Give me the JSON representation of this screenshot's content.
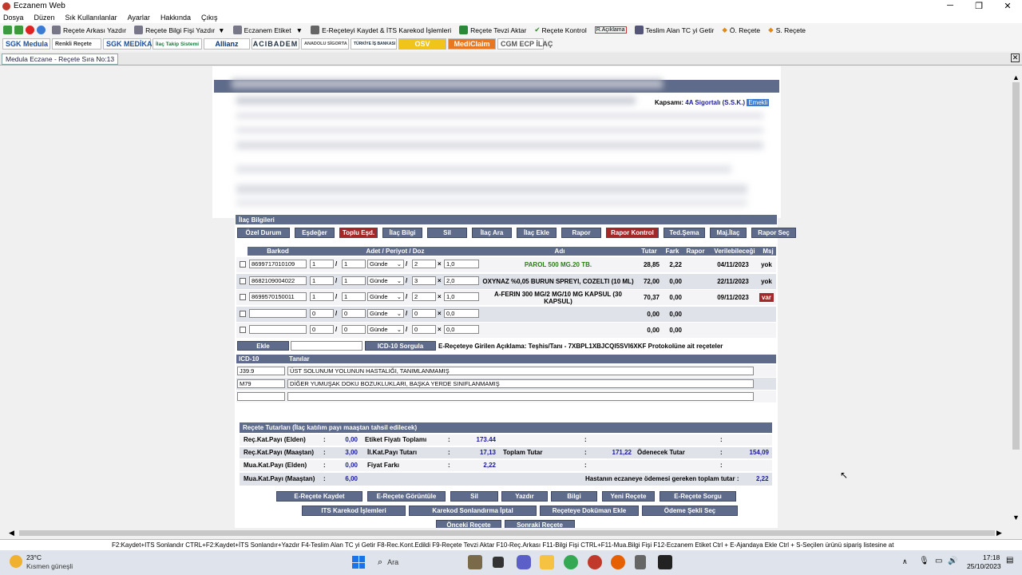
{
  "window": {
    "title": "Eczanem Web"
  },
  "menu": [
    "Dosya",
    "Düzen",
    "Sık Kullanılanlar",
    "Ayarlar",
    "Hakkında",
    "Çıkış"
  ],
  "toolbar1": [
    "Reçete Arkası Yazdır",
    "Reçete Bilgi Fişi Yazdır",
    "Eczanem Etiket",
    "E-Reçeteyi Kaydet & İTS Karekod İşlemleri",
    "Reçete Tevzi Aktar",
    "Reçete Kontrol",
    "R.Açıklama",
    "Teslim Alan TC yi Getir",
    "Ö. Reçete",
    "S. Reçete"
  ],
  "toolbar2": [
    "SGK Medula",
    "Renkli Reçete",
    "SGK MEDİKAL",
    "İlaç Takip Sistemi",
    "Allianz",
    "ACIBADEM",
    "ANADOLU SİGORTA",
    "TÜRKİYE İŞ BANKASI",
    "OSV",
    "MediClaim",
    "CGM ECP İLAÇ"
  ],
  "tab": {
    "label": "Medula Eczane - Reçete Sıra No:13"
  },
  "kapsam": {
    "label": "Kapsamı:",
    "value": "4A Sigortalı (S.S.K.)",
    "badge": "Emekli"
  },
  "ilac": {
    "section_title": "İlaç Bilgileri",
    "buttons": [
      "Özel Durum",
      "Eşdeğer",
      "Toplu Eşd.",
      "İlaç Bilgi",
      "Sil",
      "İlaç Ara",
      "İlaç Ekle",
      "Rapor",
      "Rapor Kontrol",
      "Ted.Şema",
      "Maj.İlaç",
      "Rapor Seç"
    ],
    "columns": [
      "Barkod",
      "Adet / Periyot / Doz",
      "Adı",
      "Tutar",
      "Fark",
      "Rapor",
      "Verilebileceği",
      "Msj"
    ],
    "rows": [
      {
        "barkod": "8699717010109",
        "adet": "1",
        "periyot": "1",
        "birim": "Günde",
        "doz1": "2",
        "doz2": "1,0",
        "adi": "PAROL 500 MG.20 TB.",
        "tutar": "28,85",
        "fark": "2,22",
        "rapor": "",
        "verilebilecegi": "04/11/2023",
        "msj": "yok"
      },
      {
        "barkod": "8682109004022",
        "adet": "1",
        "periyot": "1",
        "birim": "Günde",
        "doz1": "3",
        "doz2": "2,0",
        "adi": "OXYNAZ %0,05 BURUN SPREYI, COZELTI (10 ML)",
        "tutar": "72,00",
        "fark": "0,00",
        "rapor": "",
        "verilebilecegi": "22/11/2023",
        "msj": "yok"
      },
      {
        "barkod": "8699570150011",
        "adet": "1",
        "periyot": "1",
        "birim": "Günde",
        "doz1": "2",
        "doz2": "1,0",
        "adi": "A-FERIN 300 MG/2 MG/10 MG KAPSUL (30 KAPSUL)",
        "tutar": "70,37",
        "fark": "0,00",
        "rapor": "",
        "verilebilecegi": "09/11/2023",
        "msj": "var"
      },
      {
        "barkod": "",
        "adet": "0",
        "periyot": "0",
        "birim": "Günde",
        "doz1": "0",
        "doz2": "0,0",
        "adi": "",
        "tutar": "0,00",
        "fark": "0,00",
        "rapor": "",
        "verilebilecegi": "",
        "msj": ""
      },
      {
        "barkod": "",
        "adet": "0",
        "periyot": "0",
        "birim": "Günde",
        "doz1": "0",
        "doz2": "0,0",
        "adi": "",
        "tutar": "0,00",
        "fark": "0,00",
        "rapor": "",
        "verilebilecegi": "",
        "msj": ""
      }
    ],
    "ekle": "Ekle",
    "icd_sorgula": "ICD-10 Sorgula",
    "aciklama": "E-Reçeteye Girilen Açıklama: Teşhis/Tanı - 7XBPL1XBJCQI5SVI6XKF Protokolüne ait reçeteler"
  },
  "icd": {
    "columns": [
      "ICD-10",
      "Tanılar"
    ],
    "rows": [
      {
        "code": "J39.9",
        "desc": "ÜST SOLUNUM YOLUNUN HASTALIĞI, TANIMLANMAMIŞ"
      },
      {
        "code": "M79",
        "desc": "DİĞER YUMUŞAK DOKU BOZUKLUKLARI, BAŞKA YERDE SINIFLANMAMIŞ"
      },
      {
        "code": "",
        "desc": ""
      }
    ]
  },
  "tutar": {
    "title": "Reçete Tutarları (İlaç katılım payı maaştan tahsil edilecek)",
    "rec_kat_elden_label": "Reç.Kat.Payı (Elden)",
    "rec_kat_elden": "0,00",
    "etiket_label": "Etiket Fiyatı Toplamı",
    "etiket": "173.44",
    "rec_kat_maas_label": "Reç.Kat.Payı (Maaştan)",
    "rec_kat_maas": "3,00",
    "il_kat_label": "İl.Kat.Payı Tutarı",
    "il_kat": "17,13",
    "toplam_label": "Toplam Tutar",
    "toplam": "171,22",
    "odenecek_label": "Ödenecek Tutar",
    "odenecek": "154,09",
    "mua_elden_label": "Mua.Kat.Payı (Elden)",
    "mua_elden": "0,00",
    "fiyat_farki_label": "Fiyat Farkı",
    "fiyat_farki": "2,22",
    "mua_maas_label": "Mua.Kat.Payı (Maaştan)",
    "mua_maas": "6,00",
    "hasta_label": "Hastanın eczaneye ödemesi gereken toplam tutar :",
    "hasta": "2,22"
  },
  "actions": {
    "row1": [
      "E-Reçete Kaydet",
      "E-Reçete Görüntüle",
      "Sil",
      "Yazdır",
      "Bilgi",
      "Yeni Reçete",
      "E-Reçete Sorgu"
    ],
    "row2": [
      "ITS Karekod İşlemleri",
      "Karekod Sonlandırma İptal",
      "Reçeteye Doküman Ekle",
      "Ödeme Şekli Seç"
    ],
    "row3": [
      "Önceki Reçete",
      "Sonraki Reçete"
    ]
  },
  "statusbar": "F2:Kaydet+ITS Sonlandır CTRL+F2:Kaydet+İTS Sonlandır+Yazdır  F4-Teslim Alan TC yi Getir  F8-Rec.Kont.Edildi  F9-Reçete Tevzi Aktar  F10-Reç.Arkası  F11-Bilgi Fişi CTRL+F11-Mua.Bilgi Fişi  F12-Eczanem Etiket  Ctrl + E-Ajandaya Ekle  Ctrl + S-Seçilen ürünü sipariş listesine at",
  "taskbar": {
    "temp": "23°C",
    "weather": "Kısmen güneşli",
    "search": "Ara",
    "time": "17:18",
    "date": "25/10/2023"
  }
}
